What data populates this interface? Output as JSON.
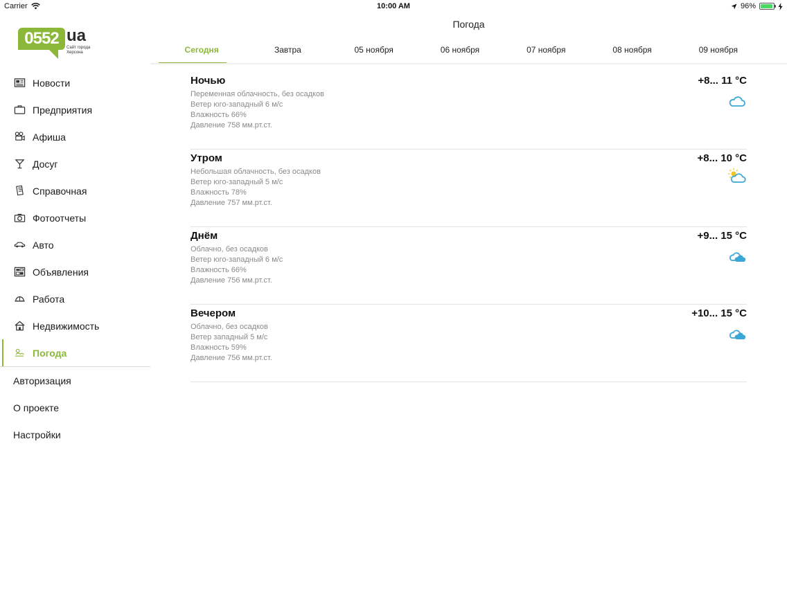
{
  "status_bar": {
    "carrier": "Carrier",
    "time": "10:00 AM",
    "battery": "96%",
    "battery_fraction": 0.96
  },
  "logo": {
    "number": "0552",
    "domain": "ua",
    "tagline": "Сайт города Херсона"
  },
  "sidebar": {
    "items": [
      {
        "label": "Новости",
        "icon": "newspaper-icon"
      },
      {
        "label": "Предприятия",
        "icon": "briefcase-icon"
      },
      {
        "label": "Афиша",
        "icon": "movie-camera-icon"
      },
      {
        "label": "Досуг",
        "icon": "cocktail-icon"
      },
      {
        "label": "Справочная",
        "icon": "book-icon"
      },
      {
        "label": "Фотоотчеты",
        "icon": "camera-icon"
      },
      {
        "label": "Авто",
        "icon": "car-icon"
      },
      {
        "label": "Объявления",
        "icon": "billboard-icon"
      },
      {
        "label": "Работа",
        "icon": "hard-hat-icon"
      },
      {
        "label": "Недвижимость",
        "icon": "house-icon"
      },
      {
        "label": "Погода",
        "icon": "weather-icon",
        "active": true
      }
    ],
    "secondary": [
      {
        "label": "Авторизация"
      },
      {
        "label": "О проекте"
      },
      {
        "label": "Настройки"
      }
    ]
  },
  "main": {
    "title": "Погода",
    "tabs": [
      "Сегодня",
      "Завтра",
      "05 ноября",
      "06 ноября",
      "07 ноября",
      "08 ноября",
      "09 ноября"
    ],
    "active_tab": 0,
    "accent_color": "#8cb83a",
    "icon_color": "#3ba7d6",
    "forecast": [
      {
        "period": "Ночью",
        "condition": "Переменная облачность, без осадков",
        "wind": "Ветер юго-западный 6 м/с",
        "humidity": "Влажность 66%",
        "pressure": "Давление 758 мм.рт.ст.",
        "temp": "+8... 11 °C",
        "icon": "cloud-outline-icon"
      },
      {
        "period": "Утром",
        "condition": "Небольшая облачность, без осадков",
        "wind": "Ветер юго-западный 5 м/с",
        "humidity": "Влажность 78%",
        "pressure": "Давление 757 мм.рт.ст.",
        "temp": "+8... 10 °C",
        "icon": "sun-cloud-icon"
      },
      {
        "period": "Днём",
        "condition": "Облачно, без осадков",
        "wind": "Ветер юго-западный 6 м/с",
        "humidity": "Влажность 66%",
        "pressure": "Давление 756 мм.рт.ст.",
        "temp": "+9... 15 °C",
        "icon": "clouds-icon"
      },
      {
        "period": "Вечером",
        "condition": "Облачно, без осадков",
        "wind": "Ветер западный 5 м/с",
        "humidity": "Влажность 59%",
        "pressure": "Давление 756 мм.рт.ст.",
        "temp": "+10... 15 °C",
        "icon": "clouds-icon"
      }
    ]
  }
}
